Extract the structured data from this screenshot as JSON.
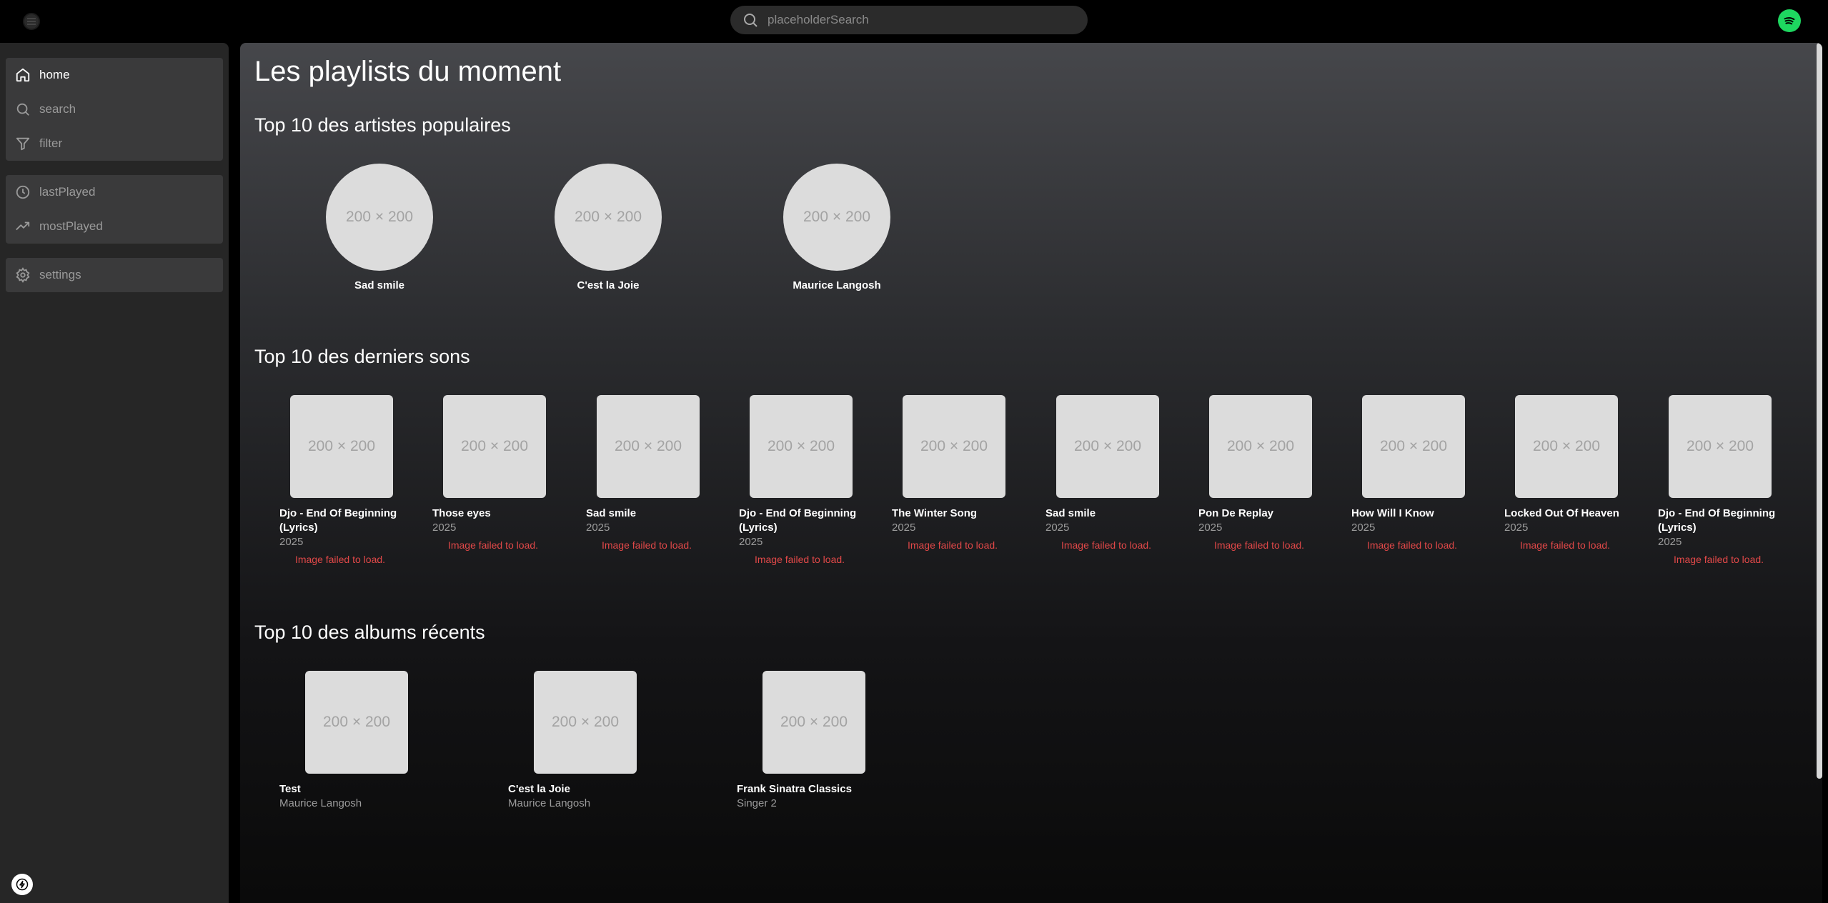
{
  "search": {
    "placeholder": "placeholderSearch"
  },
  "sidebar": {
    "items": [
      {
        "label": "home",
        "icon": "home-icon"
      },
      {
        "label": "search",
        "icon": "search-icon"
      },
      {
        "label": "filter",
        "icon": "filter-icon"
      },
      {
        "label": "lastPlayed",
        "icon": "clock-icon"
      },
      {
        "label": "mostPlayed",
        "icon": "trending-icon"
      },
      {
        "label": "settings",
        "icon": "gear-icon"
      }
    ]
  },
  "main": {
    "title": "Les playlists du moment",
    "placeholder_text": "200 × 200",
    "artists_section": {
      "title": "Top 10 des artistes populaires",
      "items": [
        "Sad smile",
        "C'est la Joie",
        "Maurice Langosh"
      ]
    },
    "songs_section": {
      "title": "Top 10 des derniers sons",
      "error_text": "Image failed to load.",
      "items": [
        {
          "title": "Djo - End Of Beginning (Lyrics)",
          "year": "2025"
        },
        {
          "title": "Those eyes",
          "year": "2025"
        },
        {
          "title": "Sad smile",
          "year": "2025"
        },
        {
          "title": "Djo - End Of Beginning (Lyrics)",
          "year": "2025"
        },
        {
          "title": "The Winter Song",
          "year": "2025"
        },
        {
          "title": "Sad smile",
          "year": "2025"
        },
        {
          "title": "Pon De Replay",
          "year": "2025"
        },
        {
          "title": "How Will I Know",
          "year": "2025"
        },
        {
          "title": "Locked Out Of Heaven",
          "year": "2025"
        },
        {
          "title": "Djo - End Of Beginning (Lyrics)",
          "year": "2025"
        }
      ]
    },
    "albums_section": {
      "title": "Top 10 des albums récents",
      "items": [
        {
          "title": "Test",
          "artist": "Maurice Langosh"
        },
        {
          "title": "C'est la Joie",
          "artist": "Maurice Langosh"
        },
        {
          "title": "Frank Sinatra Classics",
          "artist": "Singer 2"
        }
      ]
    }
  },
  "colors": {
    "accent": "#1ed760",
    "error": "#e04848",
    "nav_group_bg": "#3a3a3b"
  }
}
